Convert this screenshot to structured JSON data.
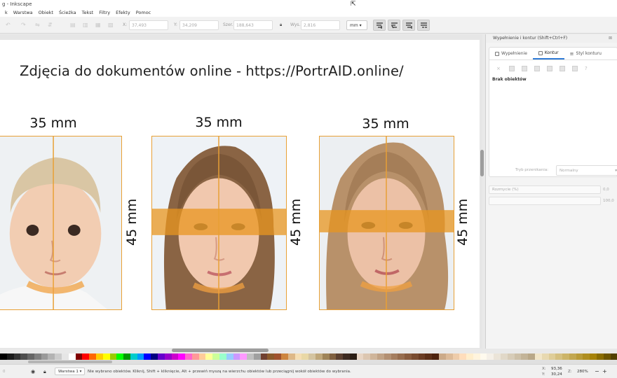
{
  "window": {
    "title": "g - Inkscape"
  },
  "menu": [
    "k",
    "Warstwa",
    "Obiekt",
    "Ścieżka",
    "Tekst",
    "Filtry",
    "Efekty",
    "Pomoc"
  ],
  "toolbar": {
    "x_label": "X:",
    "x_value": "37,493",
    "y_label": "Y:",
    "y_value": "34,209",
    "w_label": "Szer.:",
    "w_value": "188,643",
    "h_label": "Wys.:",
    "h_value": "2,816",
    "unit": "mm"
  },
  "canvas": {
    "headline": "Zdjęcia do dokumentów online - https://PortrAID.online/",
    "photos": [
      {
        "width_label": "35 mm",
        "height_label": "45 mm",
        "subject": "child"
      },
      {
        "width_label": "35 mm",
        "height_label": "45 mm",
        "subject": "girl"
      },
      {
        "width_label": "35 mm",
        "height_label": "45 mm",
        "subject": "woman"
      }
    ]
  },
  "dock": {
    "title": "Wypełnienie i kontur (Shift+Ctrl+F)",
    "tabs": [
      "Wypełnienie",
      "Kontur",
      "Styl konturu"
    ],
    "active_tab": 1,
    "no_objects": "Brak obiektów",
    "blend_label": "Tryb przenikania:",
    "blend_value": "Normalny",
    "blur_label": "Rozmycie (%)",
    "blur_value": "0,0",
    "opacity_value": "100,0"
  },
  "palette": [
    "#000000",
    "#1a1a1a",
    "#333333",
    "#4d4d4d",
    "#666666",
    "#808080",
    "#999999",
    "#b3b3b3",
    "#cccccc",
    "#e6e6e6",
    "#ffffff",
    "#800000",
    "#ff0000",
    "#ff6600",
    "#ffcc00",
    "#ffff00",
    "#99cc00",
    "#00ff00",
    "#009900",
    "#00cccc",
    "#0099ff",
    "#0000ff",
    "#000080",
    "#6600cc",
    "#9900cc",
    "#cc00cc",
    "#ff00ff",
    "#ff66cc",
    "#ff9999",
    "#ffcc99",
    "#ffff99",
    "#ccff99",
    "#99ffcc",
    "#99ccff",
    "#cc99ff",
    "#ff99ff",
    "#c0c0c0",
    "#a0a0a0",
    "#704030",
    "#8b5a2b",
    "#a0522d",
    "#cd853f",
    "#deb887",
    "#f5deb3",
    "#e9d8a6",
    "#d4c4a0",
    "#bfa77a",
    "#9f8458",
    "#806040",
    "#5c4030",
    "#3d2a20",
    "#2b1d14",
    "#e8d5c4",
    "#dcc6b0",
    "#cfb59a",
    "#c1a386",
    "#b39072",
    "#a57e5f",
    "#976d4e",
    "#895c3e",
    "#7a4c30",
    "#6b3d23",
    "#5c2f17",
    "#4d220d",
    "#ccaa88",
    "#ddbb99",
    "#eeccaa",
    "#ffddbb",
    "#ffeecc",
    "#fff4dd",
    "#fffaee",
    "#f5f0e8",
    "#ebe4d8",
    "#e1d8c8",
    "#d7ccb8",
    "#cdc0a8",
    "#c3b498",
    "#b9a888",
    "#f2e6c8",
    "#e8d9b0",
    "#dfcd98",
    "#d5c080",
    "#ccb468",
    "#c2a750",
    "#b99b38",
    "#af8e20",
    "#a68208",
    "#8a6c00",
    "#6e5600",
    "#524000"
  ],
  "status": {
    "layer": "Warstwa 1",
    "message": "Nie wybrano obiektów. Kliknij, Shift + kliknięcie, Alt + przewiń myszą na wierzchu obiektów lub przeciągnij wokół obiektów do wybrania.",
    "x_label": "X:",
    "x_value": "93,36",
    "y_label": "Y:",
    "y_value": "30,24",
    "z_label": "Z:",
    "zoom": "280%",
    "zoom_minus": "−",
    "zoom_plus": "+",
    "left_value": "0"
  }
}
